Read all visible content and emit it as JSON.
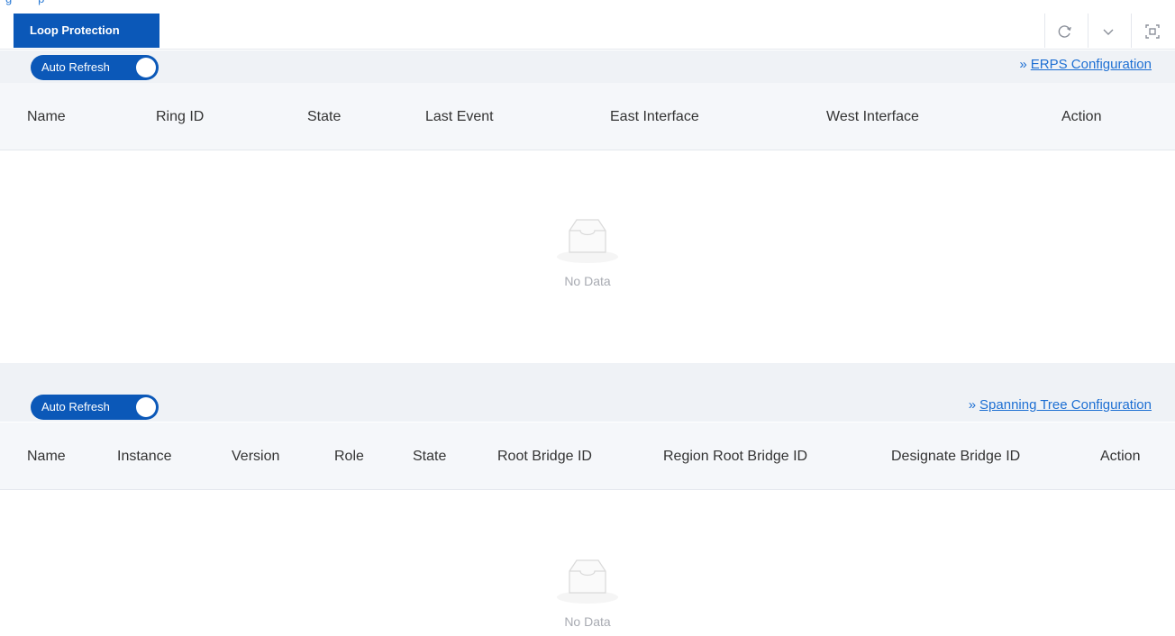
{
  "tabs": [
    {
      "label": "Loop Protection",
      "active": true
    }
  ],
  "toolbar_icons": [
    "refresh-icon",
    "chevron-down-icon",
    "fullscreen-icon"
  ],
  "colors": {
    "accent": "#0b58b8",
    "link": "#1d6fd3",
    "header_bg": "#f5f7fa",
    "strip_bg": "#eff2f6"
  },
  "erps": {
    "auto_refresh_label": "Auto Refresh",
    "auto_refresh_on": true,
    "config_link_chevron": "»",
    "config_link": "ERPS Configuration",
    "columns": [
      "Name",
      "Ring ID",
      "State",
      "Last Event",
      "East Interface",
      "West Interface",
      "Action"
    ],
    "rows": [],
    "empty_text": "No Data"
  },
  "stp": {
    "auto_refresh_label": "Auto Refresh",
    "auto_refresh_on": true,
    "config_link_chevron": "»",
    "config_link": "Spanning Tree Configuration",
    "columns": [
      "Name",
      "Instance",
      "Version",
      "Role",
      "State",
      "Root Bridge ID",
      "Region Root Bridge ID",
      "Designate Bridge ID",
      "Action"
    ],
    "rows": [],
    "empty_text": "No Data"
  }
}
